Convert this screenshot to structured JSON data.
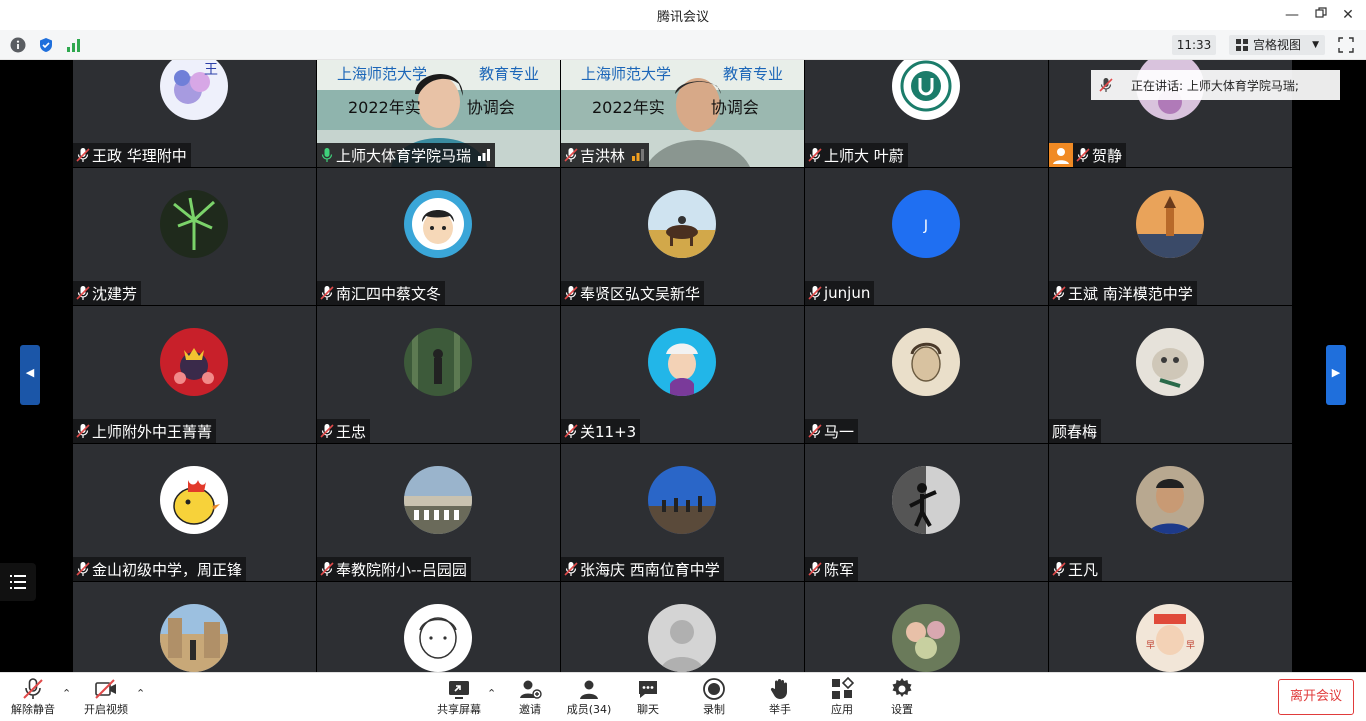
{
  "window": {
    "title": "腾讯会议"
  },
  "infobar": {
    "time": "11:33",
    "view_mode": "宫格视图"
  },
  "speaking_banner": {
    "text": "正在讲话: 上师大体育学院马瑞;"
  },
  "video_tiles": {
    "banner_line1": "上海师范大学",
    "banner_line1_right": "教育专业",
    "banner_line2_left": "2022年实",
    "banner_line2_right": "协调会"
  },
  "participants": [
    {
      "name": "王政 华理附中",
      "muted": true
    },
    {
      "name": "上师大体育学院马瑞",
      "muted": false,
      "video": true,
      "speaking": true
    },
    {
      "name": "吉洪林",
      "muted": true,
      "video": true
    },
    {
      "name": "上师大 叶蔚",
      "muted": true
    },
    {
      "name": "贺静",
      "muted": true,
      "badge": "person"
    },
    {
      "name": "沈建芳",
      "muted": true
    },
    {
      "name": "南汇四中蔡文冬",
      "muted": true
    },
    {
      "name": "奉贤区弘文吴新华",
      "muted": true
    },
    {
      "name": "junjun",
      "muted": true,
      "initial": "J"
    },
    {
      "name": "王斌 南洋模范中学",
      "muted": true
    },
    {
      "name": "上师附外中王菁菁",
      "muted": true
    },
    {
      "name": "王忠",
      "muted": true
    },
    {
      "name": "关11+3",
      "muted": true
    },
    {
      "name": "马一",
      "muted": true
    },
    {
      "name": "顾春梅",
      "muted": false
    },
    {
      "name": "金山初级中学，周正锋",
      "muted": true
    },
    {
      "name": "奉教院附小--吕园园",
      "muted": true
    },
    {
      "name": "张海庆 西南位育中学",
      "muted": true
    },
    {
      "name": "陈军",
      "muted": true
    },
    {
      "name": "王凡",
      "muted": true
    },
    {
      "name": "",
      "muted": false
    },
    {
      "name": "",
      "muted": false
    },
    {
      "name": "",
      "muted": false
    },
    {
      "name": "",
      "muted": false
    },
    {
      "name": "",
      "muted": false
    }
  ],
  "toolbar": {
    "unmute": "解除静音",
    "start_video": "开启视频",
    "share_screen": "共享屏幕",
    "invite": "邀请",
    "members": "成员(34)",
    "chat": "聊天",
    "record": "录制",
    "raise_hand": "举手",
    "apps": "应用",
    "settings": "设置",
    "leave": "离开会议"
  },
  "colors": {
    "accent": "#1f6fdc",
    "leave": "#e03b3b",
    "tile_bg": "#2d2f33",
    "speaking": "#2fc26a"
  }
}
